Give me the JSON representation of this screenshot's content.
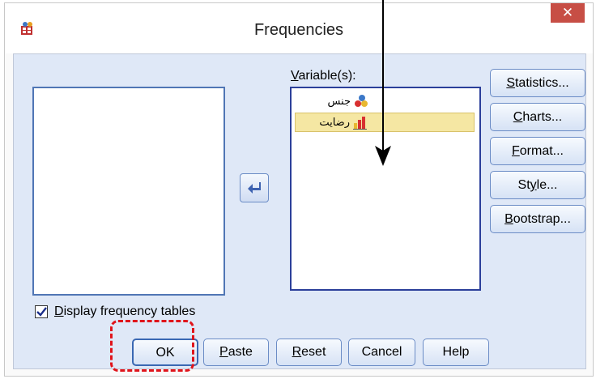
{
  "window": {
    "title": "Frequencies",
    "close_glyph": "✕"
  },
  "variables": {
    "label_prefix": "",
    "label_underlined": "V",
    "label_rest": "ariable(s):",
    "items": [
      {
        "name": "جنس",
        "icon": "nominal-icon",
        "selected": false
      },
      {
        "name": "رضایت",
        "icon": "scale-bar-icon",
        "selected": true
      }
    ]
  },
  "side_buttons": [
    {
      "id": "statistics",
      "u": "S",
      "rest": "tatistics..."
    },
    {
      "id": "charts",
      "u": "C",
      "rest": "harts..."
    },
    {
      "id": "format",
      "u": "F",
      "rest": "ormat..."
    },
    {
      "id": "style",
      "pre": "St",
      "u": "y",
      "rest": "le..."
    },
    {
      "id": "bootstrap",
      "u": "B",
      "rest": "ootstrap..."
    }
  ],
  "checkbox": {
    "u": "D",
    "rest": "isplay frequency tables",
    "checked": true
  },
  "bottom_buttons": {
    "ok": "OK",
    "paste_u": "P",
    "paste_rest": "aste",
    "reset_u": "R",
    "reset_rest": "eset",
    "cancel": "Cancel",
    "help": "Help"
  },
  "colors": {
    "client_bg": "#dfe8f7",
    "close_bg": "#c74e45",
    "selected_bg": "#f5e7a3",
    "annotation_red": "#e0141b"
  }
}
